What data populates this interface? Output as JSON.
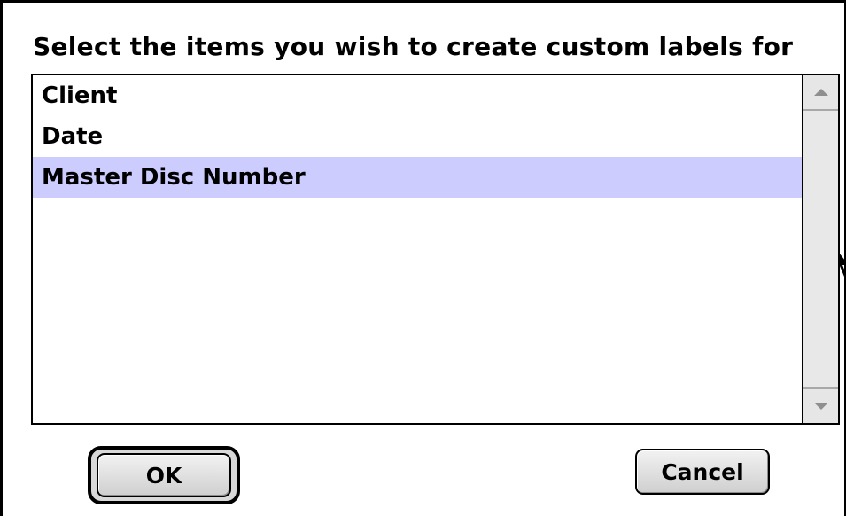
{
  "dialog": {
    "prompt": "Select the items you wish to create custom labels for"
  },
  "list": {
    "items": [
      {
        "label": "Client",
        "selected": false
      },
      {
        "label": "Date",
        "selected": false
      },
      {
        "label": "Master Disc Number",
        "selected": true
      }
    ],
    "selection_color": "#ccccff"
  },
  "scrollbar": {
    "up_icon": "triangle-up-icon",
    "down_icon": "triangle-down-icon"
  },
  "buttons": {
    "ok_label": "OK",
    "cancel_label": "Cancel",
    "default": "ok"
  }
}
